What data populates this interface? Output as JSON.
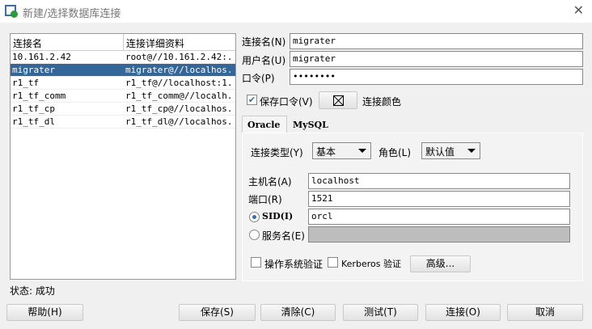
{
  "window": {
    "title": "新建/选择数据库连接",
    "close": "✕"
  },
  "list": {
    "headers": [
      "连接名",
      "连接详细资料"
    ],
    "rows": [
      {
        "name": "10.161.2.42",
        "detail": "root@//10.161.2.42:..."
      },
      {
        "name": "migrater",
        "detail": "migrater@//localhos...",
        "selected": true
      },
      {
        "name": "r1_tf",
        "detail": "r1_tf@//localhost:1..."
      },
      {
        "name": "r1_tf_comm",
        "detail": "r1_tf_comm@//localh..."
      },
      {
        "name": "r1_tf_cp",
        "detail": "r1_tf_cp@//localhos..."
      },
      {
        "name": "r1_tf_dl",
        "detail": "r1_tf_dl@//localhos..."
      }
    ]
  },
  "form": {
    "conn_name_label": "连接名(N)",
    "conn_name": "migrater",
    "user_label": "用户名(U)",
    "user": "migrater",
    "pwd_label": "口令(P)",
    "pwd": "••••••••",
    "save_pwd_label": "保存口令(V)",
    "save_pwd_checked": true,
    "color_label": "连接颜色"
  },
  "tabs": [
    "Oracle",
    "MySQL"
  ],
  "oracle": {
    "conn_type_label": "连接类型(Y)",
    "conn_type": "基本",
    "role_label": "角色(L)",
    "role": "默认值",
    "host_label": "主机名(A)",
    "host": "localhost",
    "port_label": "端口(R)",
    "port": "1521",
    "sid_label": "SID(I)",
    "sid": "orcl",
    "service_label": "服务名(E)",
    "os_auth_label": "操作系统验证",
    "kerberos_label": "Kerberos 验证",
    "advanced": "高级..."
  },
  "status": "状态: 成功",
  "buttons": {
    "help": "帮助(H)",
    "save": "保存(S)",
    "clear": "清除(C)",
    "test": "测试(T)",
    "connect": "连接(O)",
    "cancel": "取消"
  }
}
